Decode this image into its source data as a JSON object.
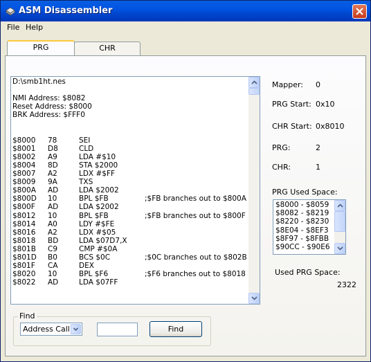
{
  "window": {
    "title": "ASM Disassembler"
  },
  "menu": [
    "File",
    "Help"
  ],
  "tabs": [
    "PRG",
    "CHR"
  ],
  "listing": {
    "header": [
      "D:\\smb1ht.nes",
      "",
      "NMI Address: $8082",
      "Reset Address: $8000",
      "BRK Address: $FFF0",
      "",
      ""
    ],
    "rows": [
      {
        "addr": "$8000",
        "byte": "78",
        "ins": "SEI",
        "cmt": ""
      },
      {
        "addr": "$8001",
        "byte": "D8",
        "ins": "CLD",
        "cmt": ""
      },
      {
        "addr": "$8002",
        "byte": "A9",
        "ins": "LDA #$10",
        "cmt": ""
      },
      {
        "addr": "$8004",
        "byte": "8D",
        "ins": "STA $2000",
        "cmt": ""
      },
      {
        "addr": "$8007",
        "byte": "A2",
        "ins": "LDX #$FF",
        "cmt": ""
      },
      {
        "addr": "$8009",
        "byte": "9A",
        "ins": "TXS",
        "cmt": ""
      },
      {
        "addr": "$800A",
        "byte": "AD",
        "ins": "LDA $2002",
        "cmt": ""
      },
      {
        "addr": "$800D",
        "byte": "10",
        "ins": "BPL $FB",
        "cmt": ";$FB branches out to $800A"
      },
      {
        "addr": "$800F",
        "byte": "AD",
        "ins": "LDA $2002",
        "cmt": ""
      },
      {
        "addr": "$8012",
        "byte": "10",
        "ins": "BPL $FB",
        "cmt": ";$FB branches out to $800F"
      },
      {
        "addr": "$8014",
        "byte": "A0",
        "ins": "LDY #$FE",
        "cmt": ""
      },
      {
        "addr": "$8016",
        "byte": "A2",
        "ins": "LDX #$05",
        "cmt": ""
      },
      {
        "addr": "$8018",
        "byte": "BD",
        "ins": "LDA $07D7,X",
        "cmt": ""
      },
      {
        "addr": "$801B",
        "byte": "C9",
        "ins": "CMP #$0A",
        "cmt": ""
      },
      {
        "addr": "$801D",
        "byte": "B0",
        "ins": "BCS $0C",
        "cmt": ";$0C branches out to $802B"
      },
      {
        "addr": "$801F",
        "byte": "CA",
        "ins": "DEX",
        "cmt": ""
      },
      {
        "addr": "$8020",
        "byte": "10",
        "ins": "BPL $F6",
        "cmt": ";$F6 branches out to $8018"
      },
      {
        "addr": "$8022",
        "byte": "AD",
        "ins": "LDA $07FF",
        "cmt": ""
      }
    ]
  },
  "info": {
    "mapper_label": "Mapper:",
    "mapper_value": "0",
    "prg_start_label": "PRG Start:",
    "prg_start_value": "0x10",
    "chr_start_label": "CHR Start:",
    "chr_start_value": "0x8010",
    "prg_label": "PRG:",
    "prg_value": "2",
    "chr_label": "CHR:",
    "chr_value": "1"
  },
  "used_space": {
    "title": "PRG Used Space:",
    "items": [
      "$8000 - $8059",
      "$8082 - $8219",
      "$8220 - $8230",
      "$8E04 - $8EF3",
      "$8F97 - $8FBB",
      "$90CC - $90E6"
    ],
    "used_label": "Used PRG Space:",
    "used_value": "2322"
  },
  "find": {
    "title": "Find",
    "dropdown_value": "Address Call",
    "input_value": "",
    "button_label": "Find"
  },
  "colors": {
    "titlebar": "#0054e3",
    "tab_highlight": "#ffc83c",
    "close_button": "#c8391a"
  }
}
